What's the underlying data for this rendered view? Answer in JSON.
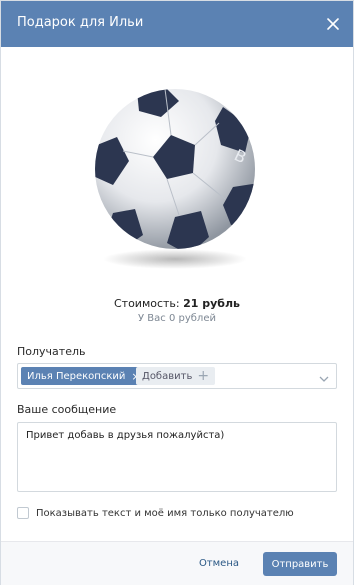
{
  "header": {
    "title": "Подарок для Ильи",
    "close_icon": "close-icon"
  },
  "gift": {
    "image": "soccer-ball",
    "cost_label": "Стоимость:",
    "cost_value": "21 рубль",
    "balance_text": "У Вас 0 рублей"
  },
  "recipient": {
    "label": "Получатель",
    "token_name": "Илья Перекопский",
    "add_label": "Добавить",
    "dropdown_icon": "chevron-down-icon"
  },
  "message": {
    "label": "Ваше сообщение",
    "value": "Привет добавь в друзья пожалуйста)"
  },
  "privacy": {
    "checkbox_label": "Показывать текст и моё имя только получателю",
    "checked": false
  },
  "footer": {
    "cancel_label": "Отмена",
    "submit_label": "Отправить"
  },
  "colors": {
    "accent": "#5b82b3",
    "link": "#2a5885"
  }
}
